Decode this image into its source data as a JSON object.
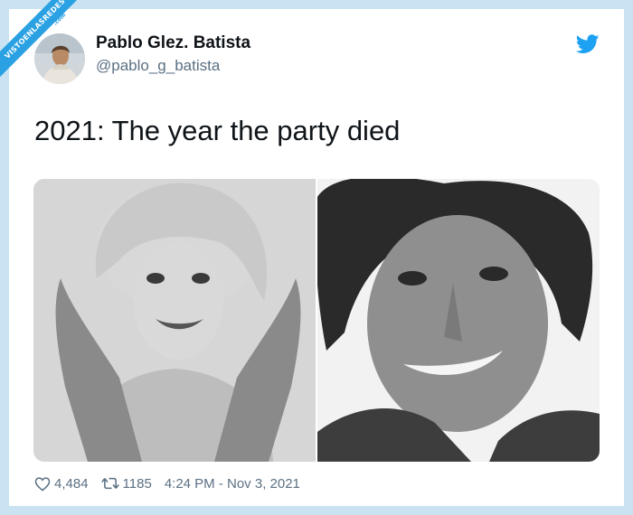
{
  "watermark": {
    "text": "VISTOENLASREDES",
    "sub": ".com"
  },
  "author": {
    "name": "Pablo Glez. Batista",
    "handle": "@pablo_g_batista"
  },
  "tweet": {
    "text": "2021: The year the party died"
  },
  "icons": {
    "brand": "twitter-bird-icon",
    "like": "heart-icon",
    "retweet": "retweet-icon"
  },
  "stats": {
    "likes": "4,484",
    "retweets": "1185",
    "timestamp": "4:24 PM - Nov 3, 2021"
  },
  "colors": {
    "brand": "#1da1f2",
    "watermark": "#2aa1e3",
    "text": "#0f1419",
    "muted": "#5b7083",
    "background": "#c9e3f2"
  }
}
